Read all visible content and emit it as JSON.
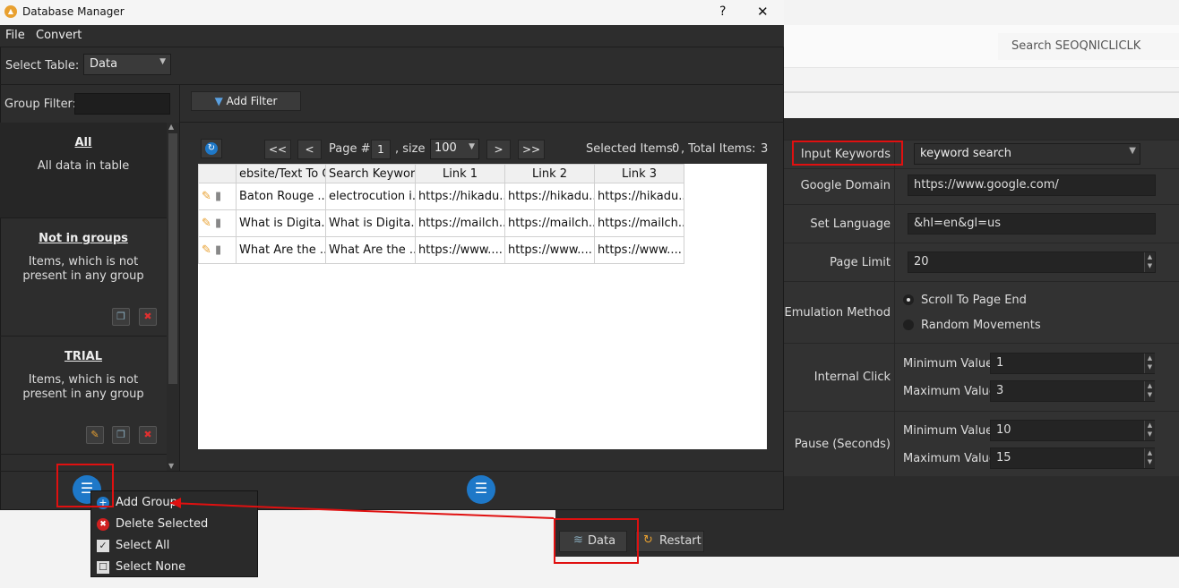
{
  "background_app": {
    "search_text": "Search SEOQNICLICLK",
    "fields": {
      "input_keywords_label": "Input Keywords",
      "input_keywords_value": "keyword search",
      "google_domain_label": "Google Domain",
      "google_domain_value": "https://www.google.com/",
      "set_language_label": "Set Language",
      "set_language_value": "&hl=en&gl=us",
      "page_limit_label": "Page Limit",
      "page_limit_value": "20",
      "emulation_label": "an Emulation Method",
      "emulation_option_1": "Scroll To Page End",
      "emulation_option_2": "Random Movements",
      "internal_click_label": "Internal Click",
      "internal_min_label": "Minimum Value",
      "internal_min_value": "1",
      "internal_max_label": "Maximum Value",
      "internal_max_value": "3",
      "pause_label": "Pause (Seconds)",
      "pause_min_label": "Minimum Value",
      "pause_min_value": "10",
      "pause_max_label": "Maximum Value",
      "pause_max_value": "15"
    },
    "buttons": {
      "data": "Data",
      "restart": "Restart"
    }
  },
  "dialog": {
    "title": "Database Manager",
    "help": "?",
    "close": "✕",
    "menu": [
      "File",
      "Convert"
    ],
    "select_table_label": "Select Table:",
    "select_table_value": "Data",
    "group_filter_label": "Group Filter:",
    "add_filter": "Add Filter",
    "groups": [
      {
        "title": "All",
        "desc_1": "All data in table",
        "desc_2": ""
      },
      {
        "title": "Not in groups",
        "desc_1": "Items, which is not",
        "desc_2": "present in any group"
      },
      {
        "title": "TRIAL",
        "desc_1": "Items, which is not",
        "desc_2": "present in any group"
      }
    ],
    "pager": {
      "first": "<<",
      "prev": "<",
      "page_label": "Page #",
      "page_value": "1",
      "size_label": ", size",
      "size_value": "100",
      "next": ">",
      "last": ">>",
      "selected_label": "Selected Items:",
      "selected_value": "0",
      "total_label": ", Total Items:",
      "total_value": "3"
    },
    "columns": [
      "",
      "ebsite/Text To Cl",
      "Search Keyword",
      "Link 1",
      "Link 2",
      "Link 3"
    ],
    "rows": [
      [
        "Baton Rouge ...",
        "electrocution i...",
        "https://hikadu...",
        "https://hikadu...",
        "https://hikadu..."
      ],
      [
        "What is Digita...",
        "What is Digita...",
        "https://mailch...",
        "https://mailch...",
        "https://mailch..."
      ],
      [
        "What Are the ...",
        "What Are the ...",
        "https://www....",
        "https://www....",
        "https://www...."
      ]
    ]
  },
  "context_menu": {
    "items": [
      "Add Group",
      "Delete Selected",
      "Select All",
      "Select None"
    ]
  },
  "colors": {
    "accent": "#1e78c8",
    "highlight": "#e01010"
  }
}
